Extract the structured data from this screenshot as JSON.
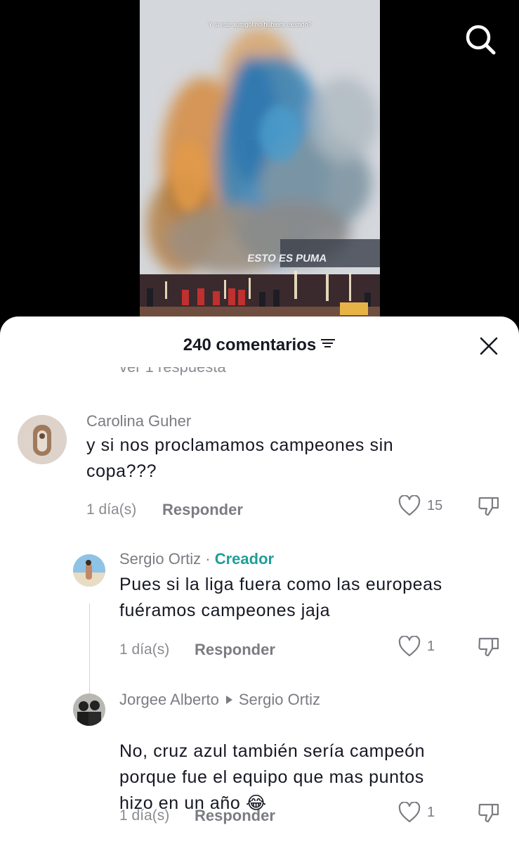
{
  "video": {
    "caption": "Y si ese autogol no hubiera existido?"
  },
  "icons": {
    "search": "search-icon",
    "close": "close-icon",
    "filter": "filter-icon",
    "like": "heart-icon",
    "dislike": "thumbs-down-icon"
  },
  "sheet": {
    "title": "240 comentarios",
    "partial_replies_text": "ver 1 respuesta"
  },
  "comments": [
    {
      "username": "Carolina Guher",
      "text": "y si nos proclamamos campeones sin\ncopa???",
      "time": "1 día(s)",
      "reply_label": "Responder",
      "likes": "15"
    },
    {
      "username": "Sergio Ortiz",
      "separator": "·",
      "badge": "Creador",
      "text": "Pues si la liga fuera como las europeas\nfuéramos campeones jaja",
      "time": "1 día(s)",
      "reply_label": "Responder",
      "likes": "1"
    },
    {
      "username": "Jorgee Alberto",
      "reply_to": "Sergio Ortiz",
      "text": "No, cruz azul también sería campeón\nporque fue el equipo que mas puntos\nhizo en un año",
      "emoji": "😂",
      "time": "1 día(s)",
      "reply_label": "Responder",
      "likes": "1"
    }
  ],
  "colors": {
    "creator_badge": "#1f9e98",
    "text": "#161823",
    "muted": "#8a8b91"
  }
}
